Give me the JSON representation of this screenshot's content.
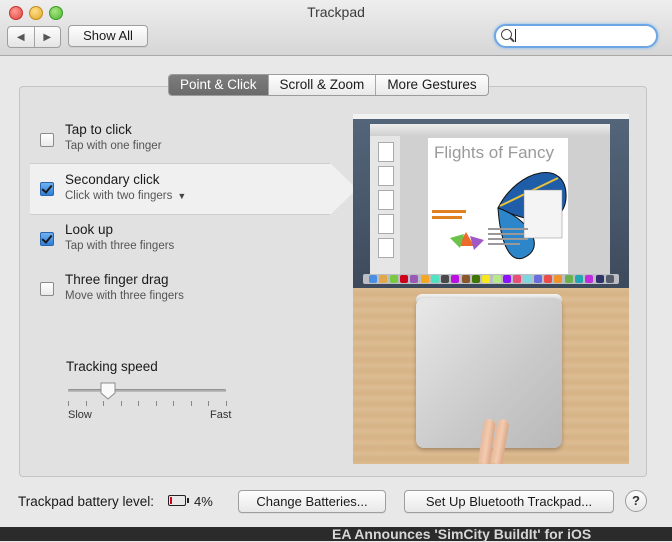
{
  "window": {
    "title": "Trackpad"
  },
  "toolbar": {
    "back_label": "◀",
    "forward_label": "▶",
    "show_all_label": "Show All",
    "search_value": ""
  },
  "tabs": [
    {
      "label": "Point & Click",
      "selected": true
    },
    {
      "label": "Scroll & Zoom",
      "selected": false
    },
    {
      "label": "More Gestures",
      "selected": false
    }
  ],
  "options": [
    {
      "title": "Tap to click",
      "subtitle": "Tap with one finger",
      "checked": false
    },
    {
      "title": "Secondary click",
      "subtitle": "Click with two fingers",
      "checked": true,
      "selected": true,
      "has_dropdown": true
    },
    {
      "title": "Look up",
      "subtitle": "Tap with three fingers",
      "checked": true
    },
    {
      "title": "Three finger drag",
      "subtitle": "Move with three fingers",
      "checked": false
    }
  ],
  "tracking": {
    "label": "Tracking speed",
    "min_label": "Slow",
    "max_label": "Fast",
    "value": 0.25,
    "ticks": 10
  },
  "preview": {
    "page_title": "Flights of Fancy"
  },
  "footer": {
    "battery_label": "Trackpad battery level:",
    "battery_percent": "4%",
    "change_batteries_label": "Change Batteries...",
    "setup_bluetooth_label": "Set Up Bluetooth Trackpad...",
    "help_label": "?"
  },
  "background_text": "EA Announces 'SimCity BuildIt' for iOS",
  "colors": {
    "accent": "#2f7fd8",
    "battery_low": "#d0021b",
    "tab_selected": "#737373"
  }
}
